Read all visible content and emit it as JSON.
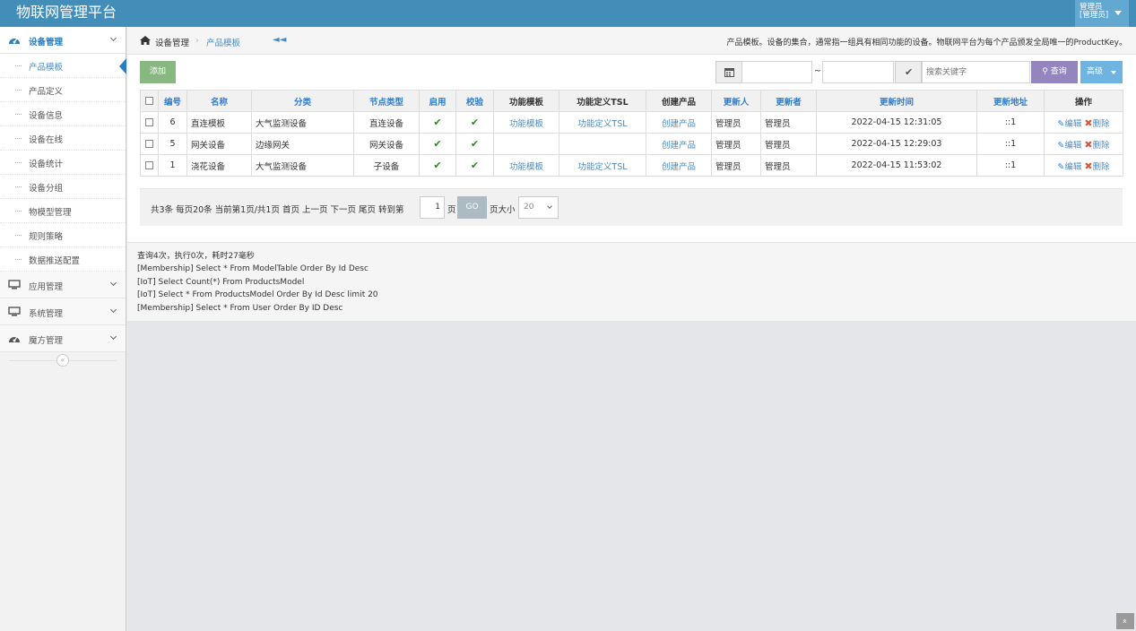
{
  "app": {
    "title": "物联网管理平台"
  },
  "user": {
    "name": "管理员",
    "role": "[管理员]"
  },
  "sidebar": {
    "group": "设备管理",
    "submenu": [
      "产品模板",
      "产品定义",
      "设备信息",
      "设备在线",
      "设备统计",
      "设备分组",
      "物模型管理",
      "规则策略",
      "数据推送配置"
    ],
    "items": [
      "应用管理",
      "系统管理",
      "魔方管理"
    ],
    "collapse": "«"
  },
  "breadcrumb": {
    "root": "设备管理",
    "sep": "›",
    "current": "产品模板",
    "back": "◄◄"
  },
  "description": "产品模板。设备的集合，通常指一组具有相同功能的设备。物联网平台为每个产品颁发全局唯一的ProductKey。",
  "toolbar": {
    "add": "添加",
    "tilde": "~",
    "search_placeholder": "搜索关键字",
    "query": "查询",
    "advanced": "高级"
  },
  "table": {
    "headers": [
      "编号",
      "名称",
      "分类",
      "节点类型",
      "启用",
      "校验",
      "功能模板",
      "功能定义TSL",
      "创建产品",
      "更新人",
      "更新者",
      "更新时间",
      "更新地址",
      "操作"
    ],
    "rows": [
      {
        "id": "6",
        "name": "直连模板",
        "category": "大气监测设备",
        "node_type": "直连设备",
        "func_tpl": "功能模板",
        "func_tsl": "功能定义TSL",
        "create": "创建产品",
        "updater": "管理员",
        "updated_by": "管理员",
        "time": "2022-04-15 12:31:05",
        "addr": "::1"
      },
      {
        "id": "5",
        "name": "网关设备",
        "category": "边缘网关",
        "node_type": "网关设备",
        "func_tpl": "",
        "func_tsl": "",
        "create": "创建产品",
        "updater": "管理员",
        "updated_by": "管理员",
        "time": "2022-04-15 12:29:03",
        "addr": "::1"
      },
      {
        "id": "1",
        "name": "浇花设备",
        "category": "大气监测设备",
        "node_type": "子设备",
        "func_tpl": "功能模板",
        "func_tsl": "功能定义TSL",
        "create": "创建产品",
        "updater": "管理员",
        "updated_by": "管理员",
        "time": "2022-04-15 11:53:02",
        "addr": "::1"
      }
    ],
    "edit": "编辑",
    "delete": "删除"
  },
  "pager": {
    "summary": "共3条  每页20条  当前第1页/共1页  首页  上一页  下一页  尾页  转到第",
    "page": "1",
    "page_unit": "页",
    "go": "GO",
    "size_label": "页大小",
    "size": "20"
  },
  "log": [
    "查询4次，执行0次，耗时27毫秒",
    "[Membership] Select * From ModelTable Order By Id Desc",
    "[IoT] Select Count(*) From ProductsModel",
    "[IoT] Select * From ProductsModel Order By Id Desc limit 20",
    "[Membership] Select * From User Order By ID Desc"
  ],
  "scroll_top": "»"
}
